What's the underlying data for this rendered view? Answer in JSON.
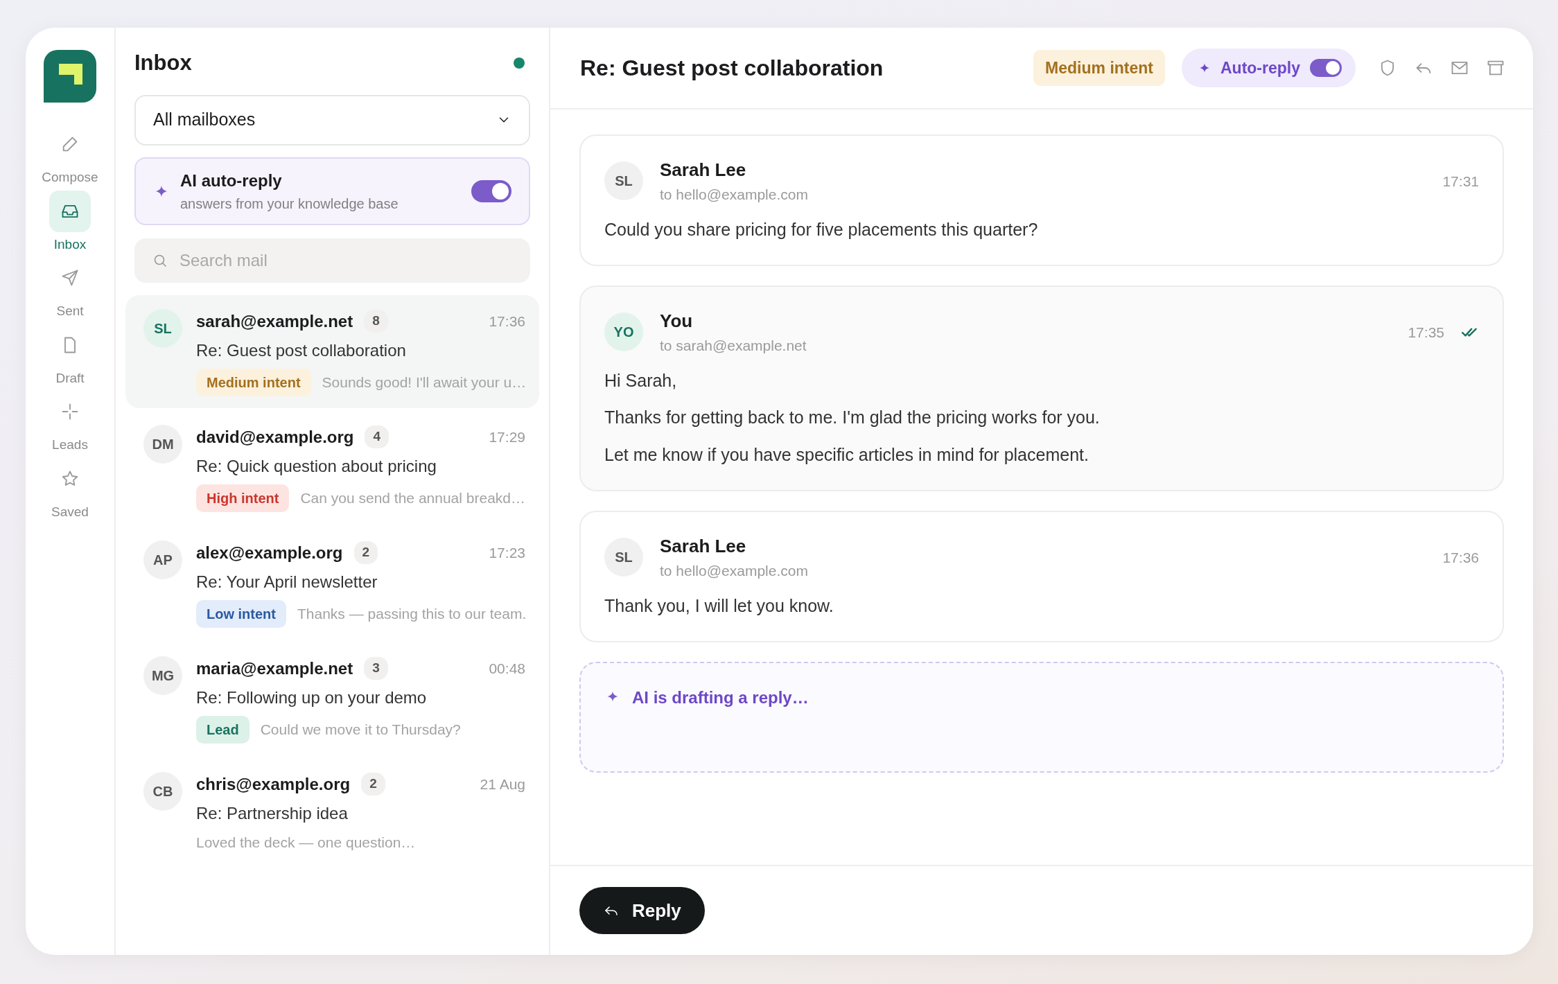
{
  "sidebar": {
    "nav": [
      {
        "label": "Compose",
        "selected": false
      },
      {
        "label": "Inbox",
        "selected": true
      },
      {
        "label": "Sent",
        "selected": false
      },
      {
        "label": "Draft",
        "selected": false
      },
      {
        "label": "Leads",
        "selected": false
      },
      {
        "label": "Saved",
        "selected": false
      }
    ]
  },
  "list": {
    "title": "Inbox",
    "online": true,
    "mailbox": "All mailboxes",
    "auto_reply": {
      "title": "AI auto-reply",
      "subtitle": "answers from your knowledge base",
      "on": true
    },
    "search": {
      "placeholder": "Search mail"
    },
    "threads": [
      {
        "initials": "SL",
        "sender": "sarah@example.net",
        "count": "8",
        "time": "17:36",
        "subject": "Re: Guest post collaboration",
        "tag": {
          "label": "Medium intent",
          "kind": "medium"
        },
        "preview": "Sounds good! I'll await your u…",
        "selected": true
      },
      {
        "initials": "DM",
        "sender": "david@example.org",
        "count": "4",
        "time": "17:29",
        "subject": "Re: Quick question about pricing",
        "tag": {
          "label": "High intent",
          "kind": "high"
        },
        "preview": "Can you send the annual breakd…",
        "selected": false
      },
      {
        "initials": "AP",
        "sender": "alex@example.org",
        "count": "2",
        "time": "17:23",
        "subject": "Re: Your April newsletter",
        "tag": {
          "label": "Low intent",
          "kind": "low"
        },
        "preview": "Thanks — passing this to our team.",
        "selected": false
      },
      {
        "initials": "MG",
        "sender": "maria@example.net",
        "count": "3",
        "time": "00:48",
        "subject": "Re: Following up on your demo",
        "tag": {
          "label": "Lead",
          "kind": "lead"
        },
        "preview": "Could we move it to Thursday?",
        "selected": false
      },
      {
        "initials": "CB",
        "sender": "chris@example.org",
        "count": "2",
        "time": "21 Aug",
        "subject": "Re: Partnership idea",
        "preview": "Loved the deck — one question…",
        "selected": false
      }
    ]
  },
  "conversation": {
    "title": "Re: Guest post collaboration",
    "intent": {
      "label": "Medium intent",
      "kind": "medium"
    },
    "auto_reply": {
      "label": "Auto-reply",
      "on": true
    },
    "messages": [
      {
        "kind": "incoming",
        "initials": "SL",
        "name": "Sarah Lee",
        "to": "to hello@example.com",
        "time": "17:31",
        "paragraphs": [
          "Could you share pricing for five placements this quarter?"
        ]
      },
      {
        "kind": "outgoing",
        "initials": "YO",
        "name": "You",
        "to": "to sarah@example.net",
        "time": "17:35",
        "read": true,
        "paragraphs": [
          "Hi Sarah,",
          "Thanks for getting back to me. I'm glad the pricing works for you.",
          "Let me know if you have specific articles in mind for placement."
        ]
      },
      {
        "kind": "incoming",
        "initials": "SL",
        "name": "Sarah Lee",
        "to": "to hello@example.com",
        "time": "17:36",
        "paragraphs": [
          "Thank you, I will let you know."
        ]
      }
    ],
    "draft": {
      "text": "AI is drafting a reply…"
    },
    "reply_button": "Reply"
  }
}
